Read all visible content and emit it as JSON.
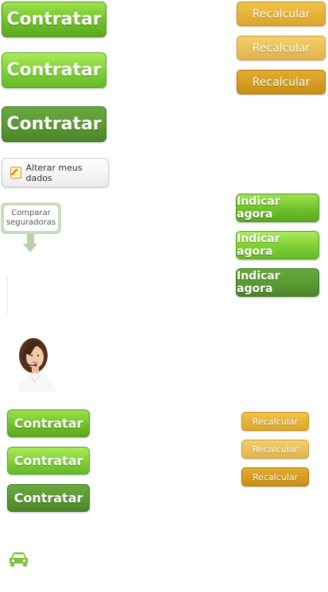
{
  "buttons": {
    "contratar_large": "Contratar",
    "contratar_small": "Contratar",
    "recalcular": "Recalcular",
    "indicar_agora": "Indicar agora",
    "alterar_meus_dados": "Alterar meus dados",
    "comparar_line1": "Comparar",
    "comparar_line2": "seguradoras"
  },
  "icons": {
    "pencil": "pencil-icon",
    "down_arrow": "down-arrow-icon",
    "car": "car-icon",
    "avatar": "support-agent-avatar"
  },
  "colors": {
    "green": "#6fc22a",
    "green_dark": "#5a9a33",
    "orange": "#dca62a",
    "car": "#7cbf3a"
  }
}
